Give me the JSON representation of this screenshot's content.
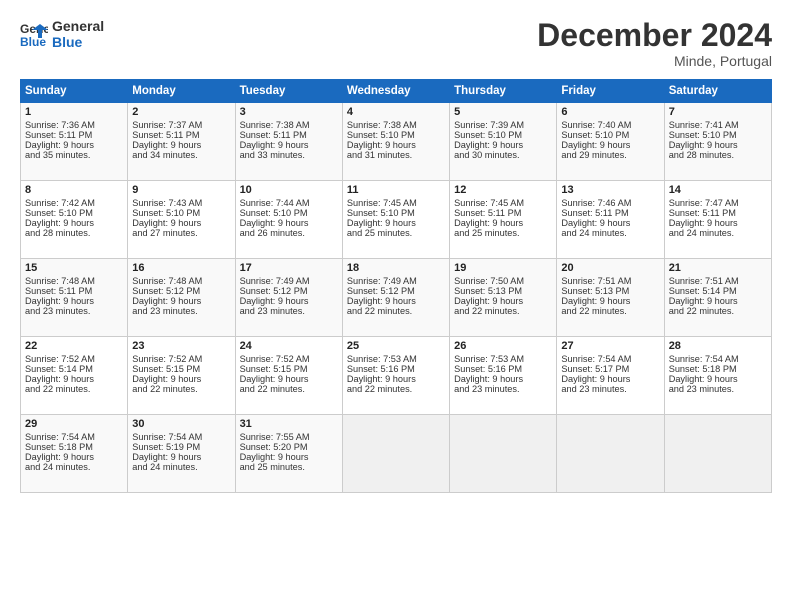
{
  "logo": {
    "line1": "General",
    "line2": "Blue"
  },
  "title": "December 2024",
  "location": "Minde, Portugal",
  "days_of_week": [
    "Sunday",
    "Monday",
    "Tuesday",
    "Wednesday",
    "Thursday",
    "Friday",
    "Saturday"
  ],
  "weeks": [
    [
      {
        "day": "1",
        "lines": [
          "Sunrise: 7:36 AM",
          "Sunset: 5:11 PM",
          "Daylight: 9 hours",
          "and 35 minutes."
        ]
      },
      {
        "day": "2",
        "lines": [
          "Sunrise: 7:37 AM",
          "Sunset: 5:11 PM",
          "Daylight: 9 hours",
          "and 34 minutes."
        ]
      },
      {
        "day": "3",
        "lines": [
          "Sunrise: 7:38 AM",
          "Sunset: 5:11 PM",
          "Daylight: 9 hours",
          "and 33 minutes."
        ]
      },
      {
        "day": "4",
        "lines": [
          "Sunrise: 7:38 AM",
          "Sunset: 5:10 PM",
          "Daylight: 9 hours",
          "and 31 minutes."
        ]
      },
      {
        "day": "5",
        "lines": [
          "Sunrise: 7:39 AM",
          "Sunset: 5:10 PM",
          "Daylight: 9 hours",
          "and 30 minutes."
        ]
      },
      {
        "day": "6",
        "lines": [
          "Sunrise: 7:40 AM",
          "Sunset: 5:10 PM",
          "Daylight: 9 hours",
          "and 29 minutes."
        ]
      },
      {
        "day": "7",
        "lines": [
          "Sunrise: 7:41 AM",
          "Sunset: 5:10 PM",
          "Daylight: 9 hours",
          "and 28 minutes."
        ]
      }
    ],
    [
      {
        "day": "8",
        "lines": [
          "Sunrise: 7:42 AM",
          "Sunset: 5:10 PM",
          "Daylight: 9 hours",
          "and 28 minutes."
        ]
      },
      {
        "day": "9",
        "lines": [
          "Sunrise: 7:43 AM",
          "Sunset: 5:10 PM",
          "Daylight: 9 hours",
          "and 27 minutes."
        ]
      },
      {
        "day": "10",
        "lines": [
          "Sunrise: 7:44 AM",
          "Sunset: 5:10 PM",
          "Daylight: 9 hours",
          "and 26 minutes."
        ]
      },
      {
        "day": "11",
        "lines": [
          "Sunrise: 7:45 AM",
          "Sunset: 5:10 PM",
          "Daylight: 9 hours",
          "and 25 minutes."
        ]
      },
      {
        "day": "12",
        "lines": [
          "Sunrise: 7:45 AM",
          "Sunset: 5:11 PM",
          "Daylight: 9 hours",
          "and 25 minutes."
        ]
      },
      {
        "day": "13",
        "lines": [
          "Sunrise: 7:46 AM",
          "Sunset: 5:11 PM",
          "Daylight: 9 hours",
          "and 24 minutes."
        ]
      },
      {
        "day": "14",
        "lines": [
          "Sunrise: 7:47 AM",
          "Sunset: 5:11 PM",
          "Daylight: 9 hours",
          "and 24 minutes."
        ]
      }
    ],
    [
      {
        "day": "15",
        "lines": [
          "Sunrise: 7:48 AM",
          "Sunset: 5:11 PM",
          "Daylight: 9 hours",
          "and 23 minutes."
        ]
      },
      {
        "day": "16",
        "lines": [
          "Sunrise: 7:48 AM",
          "Sunset: 5:12 PM",
          "Daylight: 9 hours",
          "and 23 minutes."
        ]
      },
      {
        "day": "17",
        "lines": [
          "Sunrise: 7:49 AM",
          "Sunset: 5:12 PM",
          "Daylight: 9 hours",
          "and 23 minutes."
        ]
      },
      {
        "day": "18",
        "lines": [
          "Sunrise: 7:49 AM",
          "Sunset: 5:12 PM",
          "Daylight: 9 hours",
          "and 22 minutes."
        ]
      },
      {
        "day": "19",
        "lines": [
          "Sunrise: 7:50 AM",
          "Sunset: 5:13 PM",
          "Daylight: 9 hours",
          "and 22 minutes."
        ]
      },
      {
        "day": "20",
        "lines": [
          "Sunrise: 7:51 AM",
          "Sunset: 5:13 PM",
          "Daylight: 9 hours",
          "and 22 minutes."
        ]
      },
      {
        "day": "21",
        "lines": [
          "Sunrise: 7:51 AM",
          "Sunset: 5:14 PM",
          "Daylight: 9 hours",
          "and 22 minutes."
        ]
      }
    ],
    [
      {
        "day": "22",
        "lines": [
          "Sunrise: 7:52 AM",
          "Sunset: 5:14 PM",
          "Daylight: 9 hours",
          "and 22 minutes."
        ]
      },
      {
        "day": "23",
        "lines": [
          "Sunrise: 7:52 AM",
          "Sunset: 5:15 PM",
          "Daylight: 9 hours",
          "and 22 minutes."
        ]
      },
      {
        "day": "24",
        "lines": [
          "Sunrise: 7:52 AM",
          "Sunset: 5:15 PM",
          "Daylight: 9 hours",
          "and 22 minutes."
        ]
      },
      {
        "day": "25",
        "lines": [
          "Sunrise: 7:53 AM",
          "Sunset: 5:16 PM",
          "Daylight: 9 hours",
          "and 22 minutes."
        ]
      },
      {
        "day": "26",
        "lines": [
          "Sunrise: 7:53 AM",
          "Sunset: 5:16 PM",
          "Daylight: 9 hours",
          "and 23 minutes."
        ]
      },
      {
        "day": "27",
        "lines": [
          "Sunrise: 7:54 AM",
          "Sunset: 5:17 PM",
          "Daylight: 9 hours",
          "and 23 minutes."
        ]
      },
      {
        "day": "28",
        "lines": [
          "Sunrise: 7:54 AM",
          "Sunset: 5:18 PM",
          "Daylight: 9 hours",
          "and 23 minutes."
        ]
      }
    ],
    [
      {
        "day": "29",
        "lines": [
          "Sunrise: 7:54 AM",
          "Sunset: 5:18 PM",
          "Daylight: 9 hours",
          "and 24 minutes."
        ]
      },
      {
        "day": "30",
        "lines": [
          "Sunrise: 7:54 AM",
          "Sunset: 5:19 PM",
          "Daylight: 9 hours",
          "and 24 minutes."
        ]
      },
      {
        "day": "31",
        "lines": [
          "Sunrise: 7:55 AM",
          "Sunset: 5:20 PM",
          "Daylight: 9 hours",
          "and 25 minutes."
        ]
      },
      {
        "day": "",
        "lines": []
      },
      {
        "day": "",
        "lines": []
      },
      {
        "day": "",
        "lines": []
      },
      {
        "day": "",
        "lines": []
      }
    ]
  ]
}
